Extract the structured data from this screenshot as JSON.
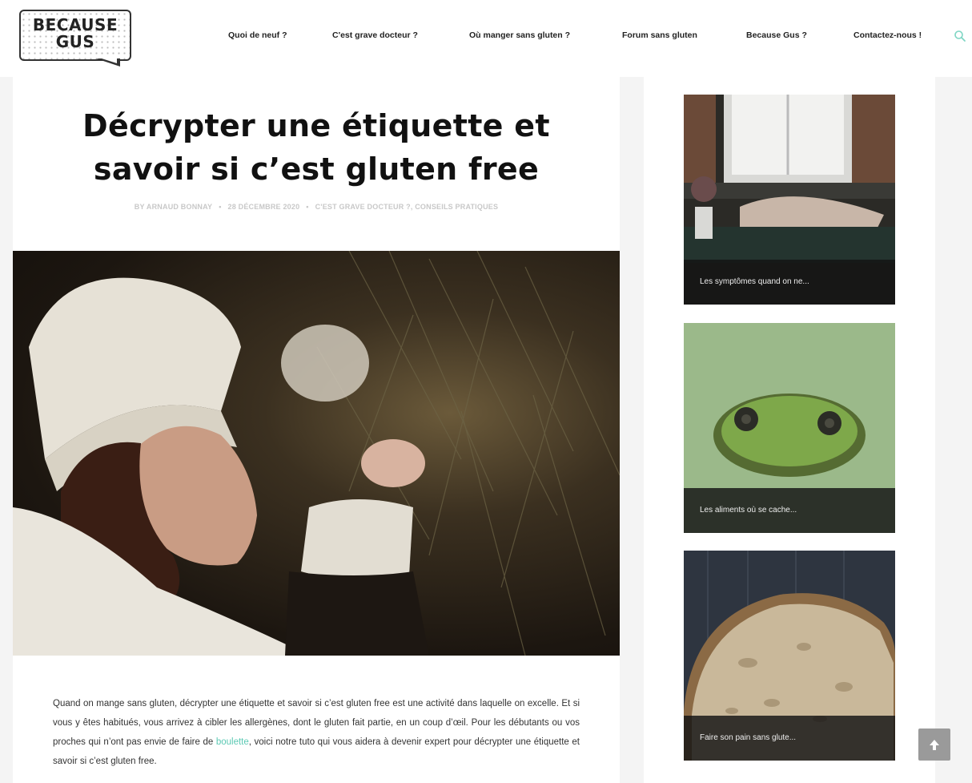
{
  "site": {
    "logo_line1": "BECAUSE",
    "logo_line2": "GUS"
  },
  "nav": {
    "items": [
      {
        "label": "Quoi de neuf ?"
      },
      {
        "label": "C'est grave docteur ?"
      },
      {
        "label": "Où manger sans gluten ?"
      },
      {
        "label": "Forum sans gluten"
      },
      {
        "label": "Because Gus ?"
      },
      {
        "label": "Contactez-nous !"
      }
    ],
    "search_icon": "search-icon"
  },
  "article": {
    "title": "Décrypter une étiquette et savoir si c’est gluten free",
    "author": "BY ARNAUD BONNAY",
    "date": "28 DÉCEMBRE 2020",
    "categories": "C'EST GRAVE DOCTEUR ?, CONSEILS PRATIQUES",
    "intro_before_link": "Quand on mange sans gluten, décrypter une étiquette et savoir si c’est gluten free est une activité dans laquelle on excelle. Et si vous y êtes habitués, vous arrivez à cibler les allergènes, dont le gluten fait partie, en un coup d’œil. Pour les débutants ou vos proches qui n’ont pas envie de faire de ",
    "intro_link": "boulette",
    "intro_after_link": ", voici notre tuto qui vous aidera à devenir expert pour décrypter une étiquette et savoir si c’est gluten free."
  },
  "sidebar": {
    "cards": [
      {
        "caption": "Les symptômes quand on ne..."
      },
      {
        "caption": "Les aliments où se cache..."
      },
      {
        "caption": "Faire son pain sans glute..."
      }
    ]
  },
  "colors": {
    "accent": "#5cc9b4",
    "meta": "#c8c8c8"
  },
  "back_to_top_icon": "arrow-up-icon"
}
